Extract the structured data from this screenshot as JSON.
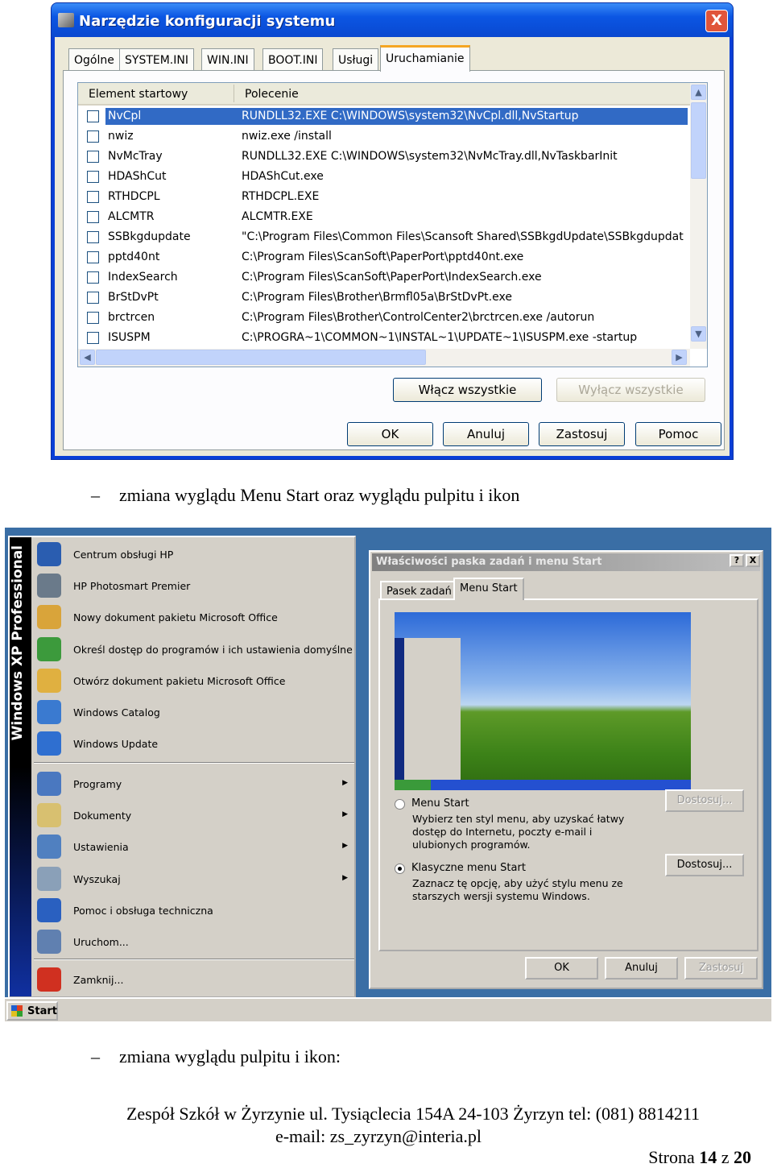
{
  "msconfig": {
    "title": "Narzędzie konfiguracji systemu",
    "tabs": [
      "Ogólne",
      "SYSTEM.INI",
      "WIN.INI",
      "BOOT.INI",
      "Usługi",
      "Uruchamianie"
    ],
    "active_tab": "Uruchamianie",
    "columns": [
      "Element startowy",
      "Polecenie"
    ],
    "rows": [
      {
        "name": "NvCpl",
        "command": "RUNDLL32.EXE C:\\WINDOWS\\system32\\NvCpl.dll,NvStartup",
        "checked": false,
        "selected": true
      },
      {
        "name": "nwiz",
        "command": "nwiz.exe /install",
        "checked": false
      },
      {
        "name": "NvMcTray",
        "command": "RUNDLL32.EXE C:\\WINDOWS\\system32\\NvMcTray.dll,NvTaskbarInit",
        "checked": false
      },
      {
        "name": "HDAShCut",
        "command": "HDAShCut.exe",
        "checked": false
      },
      {
        "name": "RTHDCPL",
        "command": "RTHDCPL.EXE",
        "checked": false
      },
      {
        "name": "ALCMTR",
        "command": "ALCMTR.EXE",
        "checked": false
      },
      {
        "name": "SSBkgdupdate",
        "command": "\"C:\\Program Files\\Common Files\\Scansoft Shared\\SSBkgdUpdate\\SSBkgdupdat",
        "checked": false
      },
      {
        "name": "pptd40nt",
        "command": "C:\\Program Files\\ScanSoft\\PaperPort\\pptd40nt.exe",
        "checked": false
      },
      {
        "name": "IndexSearch",
        "command": "C:\\Program Files\\ScanSoft\\PaperPort\\IndexSearch.exe",
        "checked": false
      },
      {
        "name": "BrStDvPt",
        "command": "C:\\Program Files\\Brother\\Brmfl05a\\BrStDvPt.exe",
        "checked": false
      },
      {
        "name": "brctrcen",
        "command": "C:\\Program Files\\Brother\\ControlCenter2\\brctrcen.exe /autorun",
        "checked": false
      },
      {
        "name": "ISUSPM",
        "command": "C:\\PROGRA~1\\COMMON~1\\INSTAL~1\\UPDATE~1\\ISUSPM.exe -startup",
        "checked": false
      }
    ],
    "enable_all": "Włącz wszystkie",
    "disable_all": "Wyłącz wszystkie",
    "ok": "OK",
    "cancel": "Anuluj",
    "apply": "Zastosuj",
    "help": "Pomoc",
    "close_glyph": "X"
  },
  "bullet1": "zmiana wyglądu Menu Start oraz wyglądu pulpitu i ikon",
  "bullet_dash": "–",
  "startmenu": {
    "band": "Windows XP Professional",
    "top_items": [
      {
        "label": "Centrum obsługi HP",
        "icon": "hp-icon",
        "color": "#2a5db0"
      },
      {
        "label": "HP Photosmart Premier",
        "icon": "camera-icon",
        "color": "#6a7a8a"
      },
      {
        "label": "Nowy dokument pakietu Microsoft Office",
        "icon": "office-new-icon",
        "color": "#d9a43a"
      },
      {
        "label": "Określ dostęp do programów i ich ustawienia domyślne",
        "icon": "program-access-icon",
        "color": "#3c9a3c"
      },
      {
        "label": "Otwórz dokument pakietu Microsoft Office",
        "icon": "office-open-icon",
        "color": "#e0b040"
      },
      {
        "label": "Windows Catalog",
        "icon": "windows-catalog-icon",
        "color": "#3a7ad0"
      },
      {
        "label": "Windows Update",
        "icon": "windows-update-icon",
        "color": "#2f6fd0"
      }
    ],
    "items": [
      {
        "label": "Programy",
        "icon": "programs-icon",
        "arrow": true,
        "color": "#4a78c0"
      },
      {
        "label": "Dokumenty",
        "icon": "documents-icon",
        "arrow": true,
        "color": "#d8c070"
      },
      {
        "label": "Ustawienia",
        "icon": "settings-icon",
        "arrow": true,
        "color": "#5080c0"
      },
      {
        "label": "Wyszukaj",
        "icon": "search-icon",
        "arrow": true,
        "color": "#8aa0b8"
      },
      {
        "label": "Pomoc i obsługa techniczna",
        "icon": "help-icon",
        "arrow": false,
        "color": "#2a60c0"
      },
      {
        "label": "Uruchom...",
        "icon": "run-icon",
        "arrow": false,
        "color": "#6080b0"
      }
    ],
    "shutdown": {
      "label": "Zamknij...",
      "icon": "shutdown-icon",
      "color": "#d03020"
    },
    "start": "Start",
    "arrow_glyph": "▶"
  },
  "taskbar_dialog": {
    "title": "Właściwości paska zadań i menu Start",
    "help_glyph": "?",
    "close_glyph": "X",
    "tabs": [
      "Pasek zadań",
      "Menu Start"
    ],
    "active_tab": "Menu Start",
    "options": [
      {
        "label": "Menu Start",
        "desc": "Wybierz ten styl menu, aby uzyskać łatwy dostęp do Internetu, poczty e-mail i ulubionych programów.",
        "selected": false,
        "customize": "Dostosuj...",
        "customize_enabled": false
      },
      {
        "label": "Klasyczne menu Start",
        "desc": "Zaznacz tę opcję, aby użyć stylu menu ze starszych wersji systemu Windows.",
        "selected": true,
        "customize": "Dostosuj...",
        "customize_enabled": true
      }
    ],
    "ok": "OK",
    "cancel": "Anuluj",
    "apply": "Zastosuj"
  },
  "bullet2": "zmiana wyglądu pulpitu i ikon:",
  "footer": {
    "line1": "Zespół Szkół w Żyrzynie ul. Tysiąclecia 154A 24-103 Żyrzyn tel: (081) 8814211",
    "line2": "e-mail: zs_zyrzyn@interia.pl",
    "page_prefix": "Strona",
    "page": "14",
    "page_sep": "z",
    "pages": "20"
  }
}
